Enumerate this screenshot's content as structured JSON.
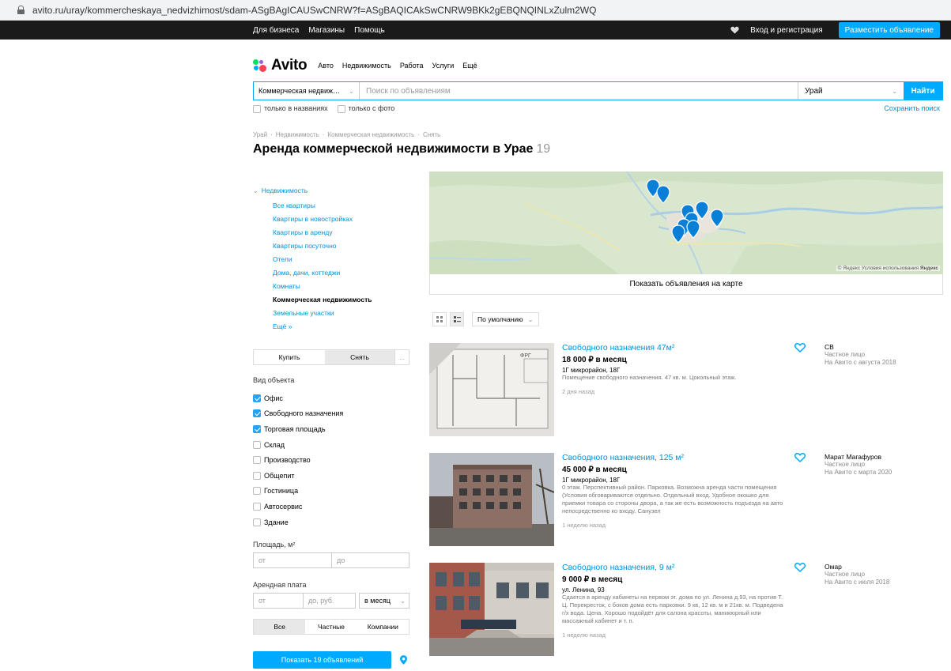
{
  "browser": {
    "url": "avito.ru/uray/kommercheskaya_nedvizhimost/sdam-ASgBAgICAUSwCNRW?f=ASgBAQICAkSwCNRW9BKk2gEBQNQINLxZulm2WQ"
  },
  "topbar": {
    "links": [
      "Для бизнеса",
      "Магазины",
      "Помощь"
    ],
    "login": "Вход и регистрация",
    "post_ad": "Разместить объявление"
  },
  "header": {
    "logo": "Avito",
    "nav": [
      "Авто",
      "Недвижимость",
      "Работа",
      "Услуги",
      "Ещё"
    ]
  },
  "search": {
    "category": "Коммерческая недвиж…",
    "placeholder": "Поиск по объявлениям",
    "city": "Урай",
    "button": "Найти",
    "titles_only": "только в названиях",
    "with_photo": "только с фото",
    "save": "Сохранить поиск"
  },
  "breadcrumbs": [
    "Урай",
    "Недвижимость",
    "Коммерческая недвижимость",
    "Снять"
  ],
  "page": {
    "title": "Аренда коммерческой недвижимости в Урае",
    "count": "19"
  },
  "categories": {
    "root": "Недвижимость",
    "items": [
      "Все квартиры",
      "Квартиры в новостройках",
      "Квартиры в аренду",
      "Квартиры посуточно",
      "Отели",
      "Дома, дачи, коттеджи",
      "Комнаты",
      "Коммерческая недвижимость",
      "Земельные участки",
      "Ещё »"
    ]
  },
  "filters": {
    "deal_buy": "Купить",
    "deal_rent": "Снять",
    "deal_more": "...",
    "type_label": "Вид объекта",
    "types": [
      {
        "label": "Офис",
        "checked": true
      },
      {
        "label": "Свободного назначения",
        "checked": true
      },
      {
        "label": "Торговая площадь",
        "checked": true
      },
      {
        "label": "Склад",
        "checked": false
      },
      {
        "label": "Производство",
        "checked": false
      },
      {
        "label": "Общепит",
        "checked": false
      },
      {
        "label": "Гостиница",
        "checked": false
      },
      {
        "label": "Автосервис",
        "checked": false
      },
      {
        "label": "Здание",
        "checked": false
      }
    ],
    "area_label": "Площадь, м²",
    "area_from": "от",
    "area_to": "до",
    "rent_label": "Арендная плата",
    "rent_from": "от",
    "rent_to": "до, руб.",
    "rent_period": "в месяц",
    "seller_all": "Все",
    "seller_private": "Частные",
    "seller_company": "Компании",
    "show_button": "Показать 19 объявлений"
  },
  "map": {
    "copyright": "© Яндекс Условия использования",
    "brand": "Яндекс",
    "show_button": "Показать объявления на карте"
  },
  "sort": {
    "selected": "По умолчанию"
  },
  "listings": [
    {
      "title": "Свободного назначения 47м²",
      "price": "18 000 ₽ в месяц",
      "address": "1Г микрорайон, 18Г",
      "description": "Помещение свободного назначения. 47 кв. м. Цокольный этаж.",
      "date": "2 дня назад",
      "seller": "СВ",
      "seller_type": "Частное лицо",
      "seller_since": "На Авито с августа 2018"
    },
    {
      "title": "Свободного назначения, 125 м²",
      "price": "45 000 ₽ в месяц",
      "address": "1Г микрорайон, 18Г",
      "description": "0 этаж. Перспективный район. Парковка. Возможна аренда части помещения (Условия обговариваются отдельно. Отдельный вход. Удобное окошко для приемки товара со стороны двора, а так же есть возможность подъезда на авто непосредственно ко входу. Санузел",
      "date": "1 неделю назад",
      "seller": "Марат Магафуров",
      "seller_type": "Частное лицо",
      "seller_since": "На Авито с марта 2020"
    },
    {
      "title": "Свободного назначения, 9 м²",
      "price": "9 000 ₽ в месяц",
      "address": "ул. Ленина, 93",
      "description": "Сдается в аренду кабинеты на первом эт. дома по ул. Ленина д.93, на против Т. Ц. Перекресток, с боков дома есть парковки. 9 кв, 12 кв. м и 21кв. м. Подведена г/х вода. Цена. Хорошо подойдёт для салона красоты, маникюрный или массажный кабинет и т. п.",
      "date": "1 неделю назад",
      "seller": "Омар",
      "seller_type": "Частное лицо",
      "seller_since": "На Авито с июля 2018"
    }
  ]
}
